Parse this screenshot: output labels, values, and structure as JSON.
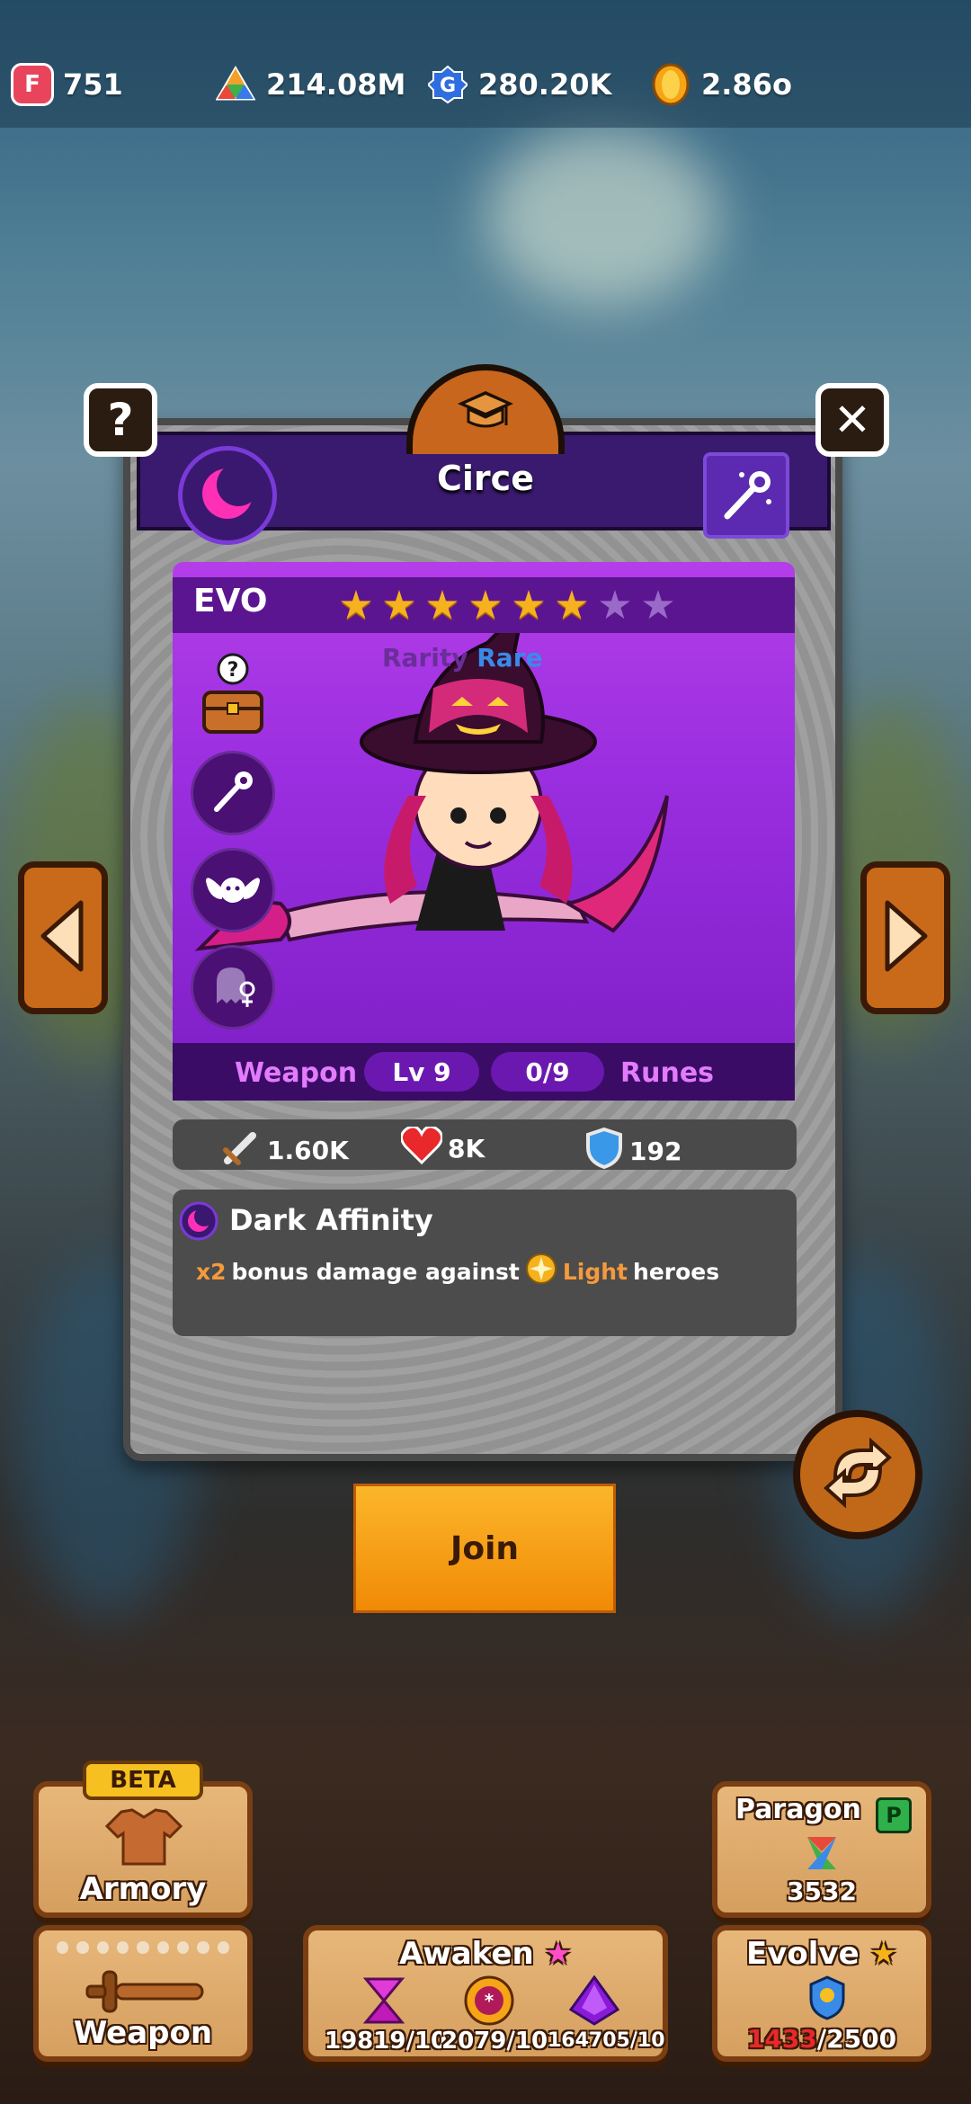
{
  "currencies": [
    {
      "icon": "f-gem-icon",
      "value": "751"
    },
    {
      "icon": "prism-icon",
      "value": "214.08M"
    },
    {
      "icon": "g-coin-icon",
      "value": "280.20K"
    },
    {
      "icon": "gold-coin-icon",
      "value": "2.86o"
    }
  ],
  "hero": {
    "name": "Circe",
    "evo_label": "EVO",
    "stars_total": 8,
    "stars_filled": 6,
    "rarity_label": "Rarity",
    "rarity_value": "Rare",
    "weapon_label": "Weapon",
    "weapon_level": "Lv 9",
    "runes_count": "0/9",
    "runes_label": "Runes"
  },
  "stats": {
    "attack": "1.60K",
    "health": "8K",
    "defense": "192"
  },
  "affinity": {
    "title": "Dark Affinity",
    "multiplier": "x2",
    "text_before": "bonus damage against",
    "element": "Light",
    "text_after": "heroes"
  },
  "join_label": "Join",
  "bottom": {
    "beta_badge": "BETA",
    "armory_label": "Armory",
    "weapon_label": "Weapon",
    "awaken_label": "Awaken",
    "awaken_values": [
      "19819/10",
      "2079/10",
      "164705/10"
    ],
    "paragon_label": "Paragon",
    "paragon_badge": "P",
    "paragon_value": "3532",
    "evolve_label": "Evolve",
    "evolve_current": "1433",
    "evolve_total": "/2500"
  },
  "colors": {
    "hero_panel": "#9a2ee0",
    "header": "#3a1a6e",
    "join_button": "#f5a316",
    "evolve_current": "#e8282a"
  }
}
